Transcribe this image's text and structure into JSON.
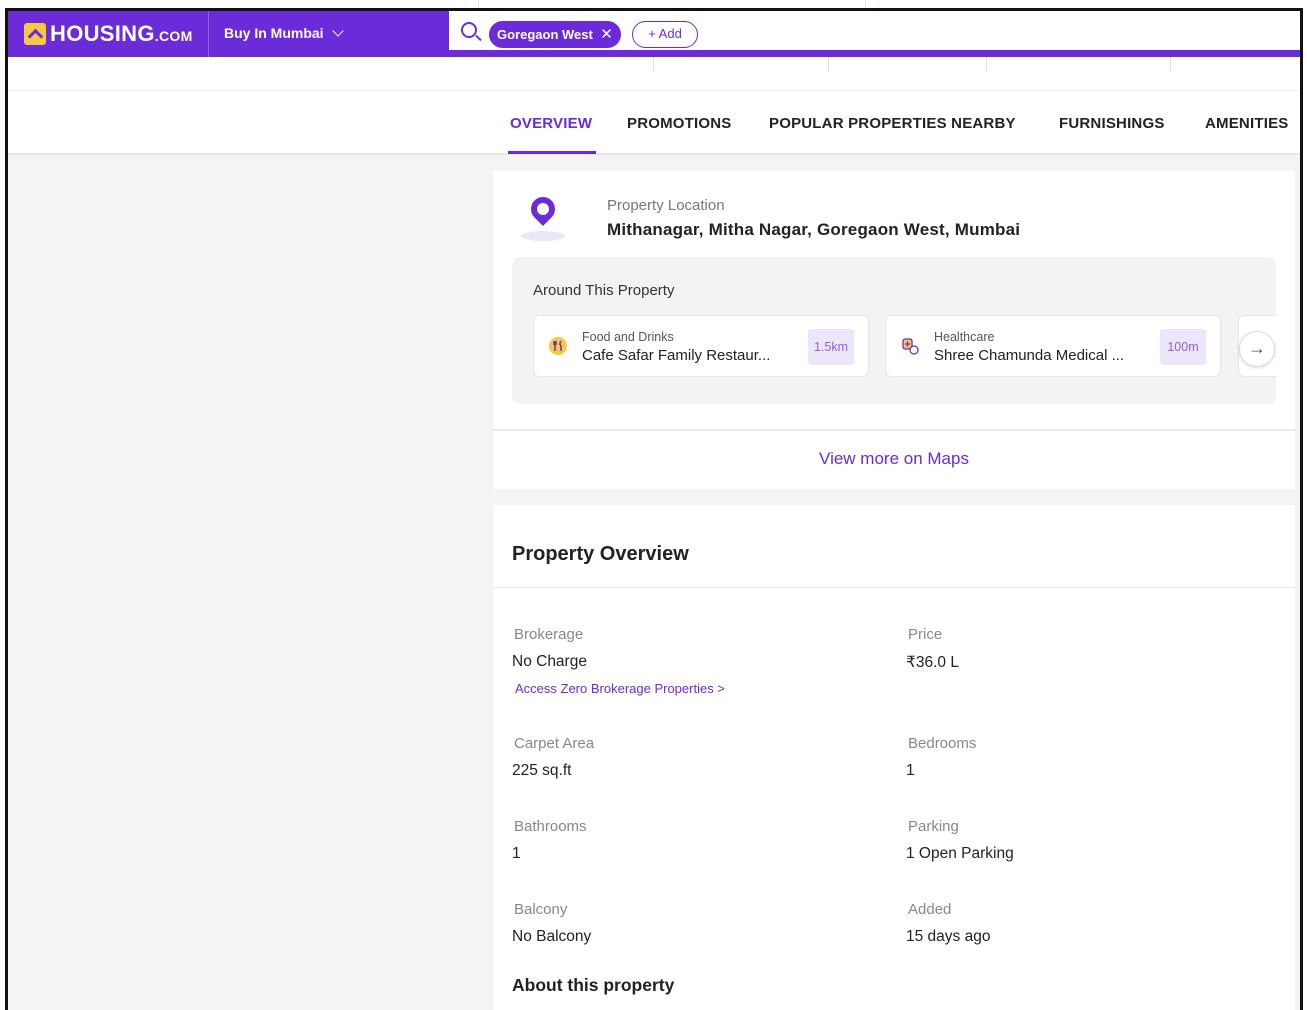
{
  "header": {
    "logo_main": "HOUSING",
    "logo_suffix": ".COM",
    "city_selector": "Buy In Mumbai",
    "search_chip": "Goregaon West",
    "add_button": "+ Add"
  },
  "tabs": [
    {
      "label": "OVERVIEW",
      "active": true
    },
    {
      "label": "PROMOTIONS"
    },
    {
      "label": "POPULAR PROPERTIES NEARBY"
    },
    {
      "label": "FURNISHINGS"
    },
    {
      "label": "AMENITIES"
    }
  ],
  "location": {
    "label": "Property Location",
    "address": "Mithanagar, Mitha Nagar, Goregaon West, Mumbai",
    "around_title": "Around This Property",
    "places": [
      {
        "category": "Food and Drinks",
        "name": "Cafe Safar Family Restaur...",
        "distance": "1.5km",
        "icon": "fork-knife-icon"
      },
      {
        "category": "Healthcare",
        "name": "Shree Chamunda Medical ...",
        "distance": "100m",
        "icon": "medical-icon"
      }
    ],
    "view_maps": "View more on Maps"
  },
  "overview": {
    "title": "Property Overview",
    "items": [
      {
        "label": "Brokerage",
        "value": "No Charge"
      },
      {
        "label": "Price",
        "value": "₹36.0 L"
      },
      {
        "label": "Carpet Area",
        "value": "225 sq.ft"
      },
      {
        "label": "Bedrooms",
        "value": "1"
      },
      {
        "label": "Bathrooms",
        "value": "1"
      },
      {
        "label": "Parking",
        "value": "1 Open Parking"
      },
      {
        "label": "Balcony",
        "value": "No Balcony"
      },
      {
        "label": "Added",
        "value": "15 days ago"
      }
    ],
    "brokerage_link": "Access Zero Brokerage Properties >",
    "about_title": "About this property"
  },
  "colors": {
    "brand": "#6b2bd9",
    "logo_yellow": "#f7c843",
    "distance_badge_bg": "#ede6fb"
  }
}
